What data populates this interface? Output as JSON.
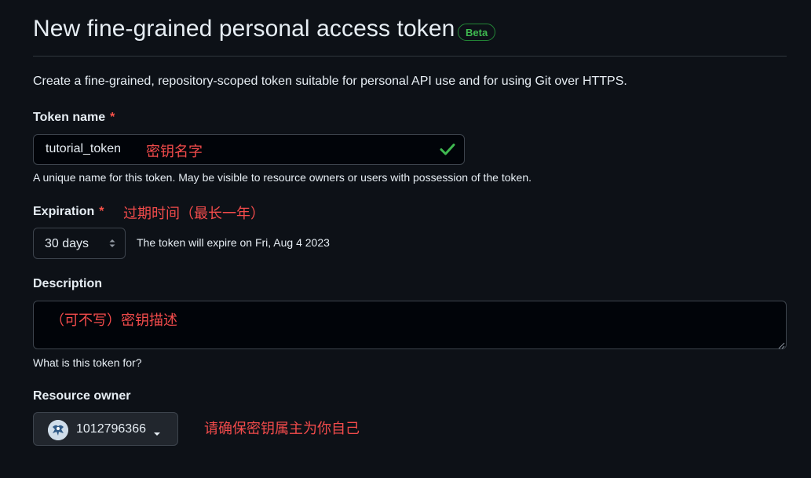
{
  "page": {
    "title": "New fine-grained personal access token",
    "beta_badge": "Beta",
    "intro": "Create a fine-grained, repository-scoped token suitable for personal API use and for using Git over HTTPS."
  },
  "token_name": {
    "label": "Token name",
    "required_mark": "*",
    "value": "tutorial_token",
    "annotation": "密钥名字",
    "hint": "A unique name for this token. May be visible to resource owners or users with possession of the token.",
    "valid_icon": "check-icon"
  },
  "expiration": {
    "label": "Expiration",
    "required_mark": "*",
    "annotation": "过期时间（最长一年）",
    "selected": "30 days",
    "expire_text": "The token will expire on Fri, Aug 4 2023"
  },
  "description": {
    "label": "Description",
    "annotation": "（可不写）密钥描述",
    "hint": "What is this token for?"
  },
  "resource_owner": {
    "label": "Resource owner",
    "selected": "1012796366",
    "annotation": "请确保密钥属主为你自己"
  },
  "colors": {
    "background": "#0d1117",
    "success": "#3fb950",
    "danger": "#f85149",
    "annotation": "#f24b4b"
  }
}
